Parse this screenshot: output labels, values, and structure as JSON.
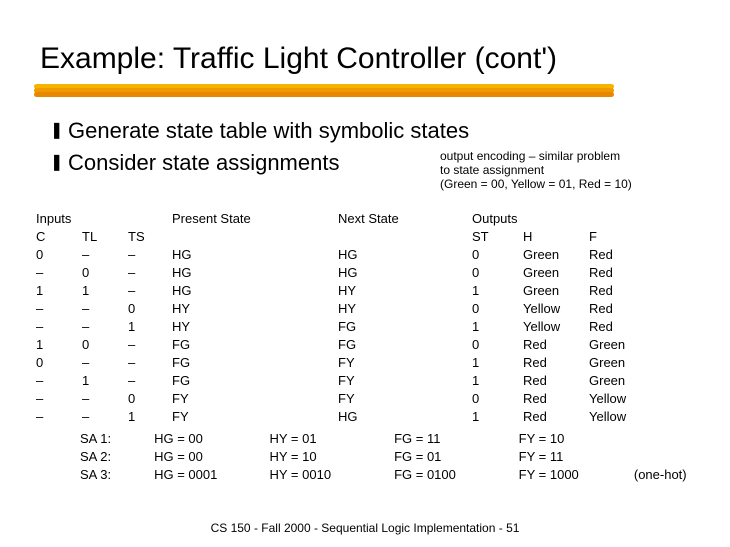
{
  "title": "Example: Traffic Light Controller (cont')",
  "bullets": [
    "Generate state table with symbolic states",
    "Consider state assignments"
  ],
  "side_note": {
    "l1": "output encoding – similar problem",
    "l2": "to state assignment",
    "l3": "(Green = 00, Yellow = 01, Red = 10)"
  },
  "table": {
    "group_labels": {
      "inputs": "Inputs",
      "present": "Present State",
      "next": "Next State",
      "outputs": "Outputs"
    },
    "headers": {
      "C": "C",
      "TL": "TL",
      "TS": "TS",
      "ST": "ST",
      "H": "H",
      "F": "F"
    },
    "rows": [
      {
        "C": "0",
        "TL": "–",
        "TS": "–",
        "PS": "HG",
        "NS": "HG",
        "ST": "0",
        "H": "Green",
        "F": "Red"
      },
      {
        "C": "–",
        "TL": "0",
        "TS": "–",
        "PS": "HG",
        "NS": "HG",
        "ST": "0",
        "H": "Green",
        "F": "Red"
      },
      {
        "C": "1",
        "TL": "1",
        "TS": "–",
        "PS": "HG",
        "NS": "HY",
        "ST": "1",
        "H": "Green",
        "F": "Red"
      },
      {
        "C": "–",
        "TL": "–",
        "TS": "0",
        "PS": "HY",
        "NS": "HY",
        "ST": "0",
        "H": "Yellow",
        "F": "Red"
      },
      {
        "C": "–",
        "TL": "–",
        "TS": "1",
        "PS": "HY",
        "NS": "FG",
        "ST": "1",
        "H": "Yellow",
        "F": "Red"
      },
      {
        "C": "1",
        "TL": "0",
        "TS": "–",
        "PS": "FG",
        "NS": "FG",
        "ST": "0",
        "H": "Red",
        "F": "Green"
      },
      {
        "C": "0",
        "TL": "–",
        "TS": "–",
        "PS": "FG",
        "NS": "FY",
        "ST": "1",
        "H": "Red",
        "F": "Green"
      },
      {
        "C": "–",
        "TL": "1",
        "TS": "–",
        "PS": "FG",
        "NS": "FY",
        "ST": "1",
        "H": "Red",
        "F": "Green"
      },
      {
        "C": "–",
        "TL": "–",
        "TS": "0",
        "PS": "FY",
        "NS": "FY",
        "ST": "0",
        "H": "Red",
        "F": "Yellow"
      },
      {
        "C": "–",
        "TL": "–",
        "TS": "1",
        "PS": "FY",
        "NS": "HG",
        "ST": "1",
        "H": "Red",
        "F": "Yellow"
      }
    ]
  },
  "encodings": {
    "rows": [
      {
        "label": "SA 1:",
        "hg": "HG = 00",
        "hy": "HY = 01",
        "fg": "FG = 11",
        "fy": "FY = 10",
        "hot": ""
      },
      {
        "label": "SA 2:",
        "hg": "HG = 00",
        "hy": "HY = 10",
        "fg": "FG = 01",
        "fy": "FY = 11",
        "hot": ""
      },
      {
        "label": "SA 3:",
        "hg": "HG = 0001",
        "hy": "HY = 0010",
        "fg": "FG = 0100",
        "fy": "FY = 1000",
        "hot": "(one-hot)"
      }
    ]
  },
  "footer": "CS 150 - Fall  2000 - Sequential Logic Implementation - 51",
  "colors": {
    "stroke1": "#f5b400",
    "stroke2": "#f09a00",
    "stroke3": "#e88800"
  }
}
